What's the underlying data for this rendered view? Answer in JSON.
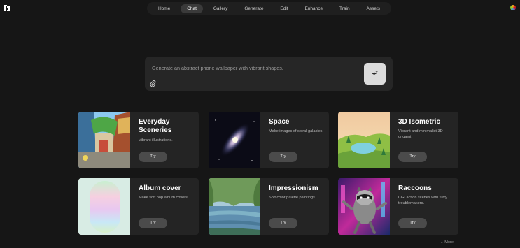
{
  "nav": {
    "items": [
      "Home",
      "Chat",
      "Gallery",
      "Generate",
      "Edit",
      "Enhance",
      "Train",
      "Assets"
    ],
    "active_index": 1
  },
  "prompt": {
    "placeholder": "Generate an abstract phone wallpaper with vibrant shapes."
  },
  "icons": {
    "logo": "logo-icon",
    "attach": "paperclip-icon",
    "generate": "sparkle-icon",
    "more": "chevron-down-icon"
  },
  "cards": [
    {
      "title": "Everyday Sceneries",
      "desc": "Vibrant illustrations.",
      "try": "Try"
    },
    {
      "title": "Space",
      "desc": "Make images of spiral galaxies.",
      "try": "Try"
    },
    {
      "title": "3D Isometric",
      "desc": "Vibrant and minimalist 3D origami.",
      "try": "Try"
    },
    {
      "title": "Album cover",
      "desc": "Make soft pop album covers.",
      "try": "Try"
    },
    {
      "title": "Impressionism",
      "desc": "Soft color palette paintings.",
      "try": "Try"
    },
    {
      "title": "Raccoons",
      "desc": "CGI action scenes with furry troublemakers.",
      "try": "Try"
    }
  ],
  "more_label": "More",
  "colors": {
    "background": "#161616",
    "card": "#242424",
    "button": "#4b4b4b",
    "active_tab": "#3a3a3a"
  }
}
